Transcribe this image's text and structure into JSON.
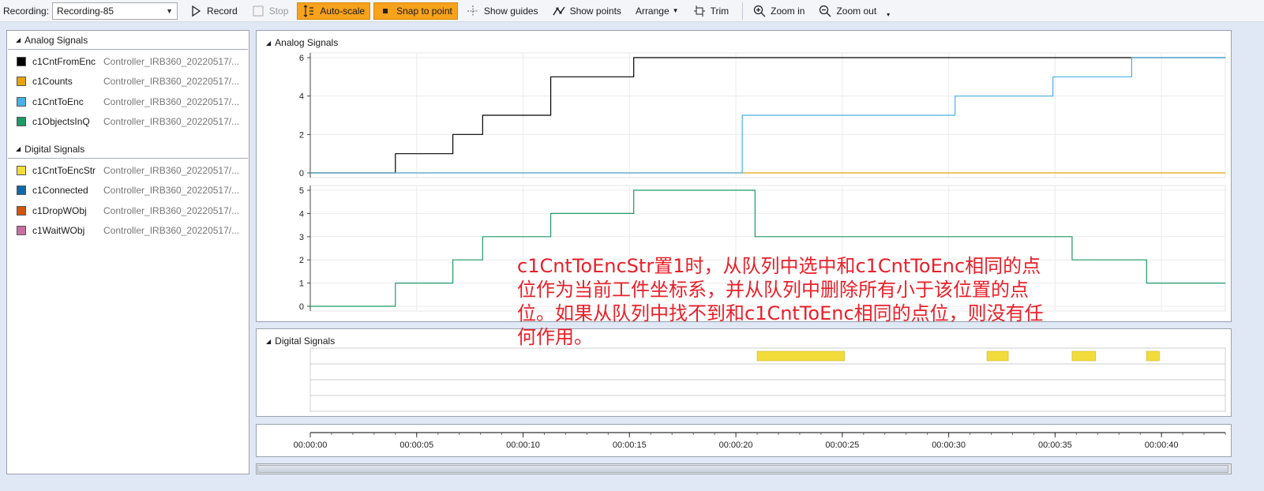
{
  "toolbar": {
    "recording_label": "Recording:",
    "recording_value": "Recording-85",
    "record": "Record",
    "stop": "Stop",
    "auto_scale": "Auto-scale",
    "snap_to_point": "Snap to point",
    "show_guides": "Show guides",
    "show_points": "Show points",
    "arrange": "Arrange",
    "trim": "Trim",
    "zoom_in": "Zoom in",
    "zoom_out": "Zoom out"
  },
  "sidebar": {
    "analog_header": "Analog Signals",
    "digital_header": "Digital Signals",
    "analog": [
      {
        "name": "c1CntFromEnc",
        "source": "Controller_IRB360_20220517/...",
        "color": "#000000"
      },
      {
        "name": "c1Counts",
        "source": "Controller_IRB360_20220517/...",
        "color": "#e8a20c"
      },
      {
        "name": "c1CntToEnc",
        "source": "Controller_IRB360_20220517/...",
        "color": "#49b0e3"
      },
      {
        "name": "c1ObjectsInQ",
        "source": "Controller_IRB360_20220517/...",
        "color": "#1e9a66"
      }
    ],
    "digital": [
      {
        "name": "c1CntToEncStr",
        "source": "Controller_IRB360_20220517/...",
        "color": "#f1dc3c"
      },
      {
        "name": "c1Connected",
        "source": "Controller_IRB360_20220517/...",
        "color": "#1268a8"
      },
      {
        "name": "c1DropWObj",
        "source": "Controller_IRB360_20220517/...",
        "color": "#d2550f"
      },
      {
        "name": "c1WaitWObj",
        "source": "Controller_IRB360_20220517/...",
        "color": "#c86fa0"
      }
    ]
  },
  "main": {
    "analog_title": "Analog Signals",
    "digital_title": "Digital Signals"
  },
  "annotation": "c1CntToEncStr置1时，从队列中选中和c1CntToEnc相同的点位作为当前工件坐标系，并从队列中删除所有小于该位置的点位。如果从队列中找不到和c1CntToEnc相同的点位，则没有任何作用。",
  "chart_data": [
    {
      "type": "line",
      "step": true,
      "xlim": [
        0,
        43
      ],
      "ylim": [
        0,
        6
      ],
      "yticks": [
        "0",
        "2",
        "4",
        "6"
      ],
      "series": [
        {
          "name": "c1CntFromEnc",
          "color": "#000000",
          "x": [
            0,
            4.0,
            6.7,
            8.1,
            11.3,
            15.2,
            38.7
          ],
          "y": [
            0,
            1,
            2,
            3,
            5,
            6,
            6
          ]
        },
        {
          "name": "c1Counts",
          "color": "#e8a20c",
          "x": [
            0,
            20.3,
            43
          ],
          "y": [
            0,
            0,
            0
          ]
        },
        {
          "name": "c1CntToEnc",
          "color": "#49b0e3",
          "x": [
            0,
            20.3,
            30.3,
            34.9,
            38.6,
            43
          ],
          "y": [
            0,
            3,
            4,
            5,
            6,
            6
          ]
        }
      ]
    },
    {
      "type": "line",
      "step": true,
      "xlim": [
        0,
        43
      ],
      "ylim": [
        0,
        5
      ],
      "yticks": [
        "0",
        "1",
        "2",
        "3",
        "4",
        "5"
      ],
      "series": [
        {
          "name": "c1ObjectsInQ",
          "color": "#1e9a66",
          "x": [
            0,
            4.0,
            6.7,
            8.1,
            11.3,
            15.2,
            20.9,
            35.8,
            39.3,
            43
          ],
          "y": [
            0,
            1,
            2,
            3,
            4,
            5,
            3,
            2,
            1,
            1
          ]
        }
      ]
    },
    {
      "type": "timeline",
      "xlim": [
        0,
        43
      ],
      "series": [
        {
          "name": "c1CntToEncStr",
          "color": "#f1dc3c",
          "intervals": [
            [
              21.0,
              25.1
            ],
            [
              31.8,
              32.8
            ],
            [
              35.8,
              36.9
            ],
            [
              39.3,
              39.9
            ]
          ]
        },
        {
          "name": "c1Connected",
          "color": "#1268a8",
          "intervals": []
        },
        {
          "name": "c1DropWObj",
          "color": "#d2550f",
          "intervals": []
        },
        {
          "name": "c1WaitWObj",
          "color": "#c86fa0",
          "intervals": []
        }
      ]
    },
    {
      "type": "time_axis",
      "xlim": [
        0,
        43
      ],
      "ticks": [
        {
          "t": 0,
          "label": "00:00:00"
        },
        {
          "t": 5,
          "label": "00:00:05"
        },
        {
          "t": 10,
          "label": "00:00:10"
        },
        {
          "t": 15,
          "label": "00:00:15"
        },
        {
          "t": 20,
          "label": "00:00:20"
        },
        {
          "t": 25,
          "label": "00:00:25"
        },
        {
          "t": 30,
          "label": "00:00:30"
        },
        {
          "t": 35,
          "label": "00:00:35"
        },
        {
          "t": 40,
          "label": "00:00:40"
        }
      ]
    }
  ]
}
